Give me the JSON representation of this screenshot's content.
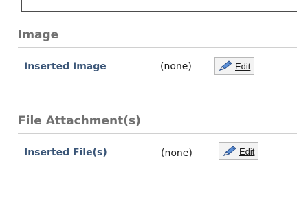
{
  "image_section": {
    "heading": "Image",
    "field_label": "Inserted Image",
    "value": "(none)",
    "edit_label": "Edit"
  },
  "attachment_section": {
    "heading": "File Attachment(s)",
    "field_label": "Inserted File(s)",
    "value": "(none)",
    "edit_label": "Edit"
  },
  "colors": {
    "heading": "#707070",
    "label": "#3a5577",
    "rule": "#d0d0d0",
    "button_bg": "#f3f3f3",
    "button_border": "#b8b8b8",
    "pencil_body": "#5b8fd6",
    "pencil_edge": "#2b4f8a"
  },
  "icons": {
    "edit": "pencil-icon"
  }
}
